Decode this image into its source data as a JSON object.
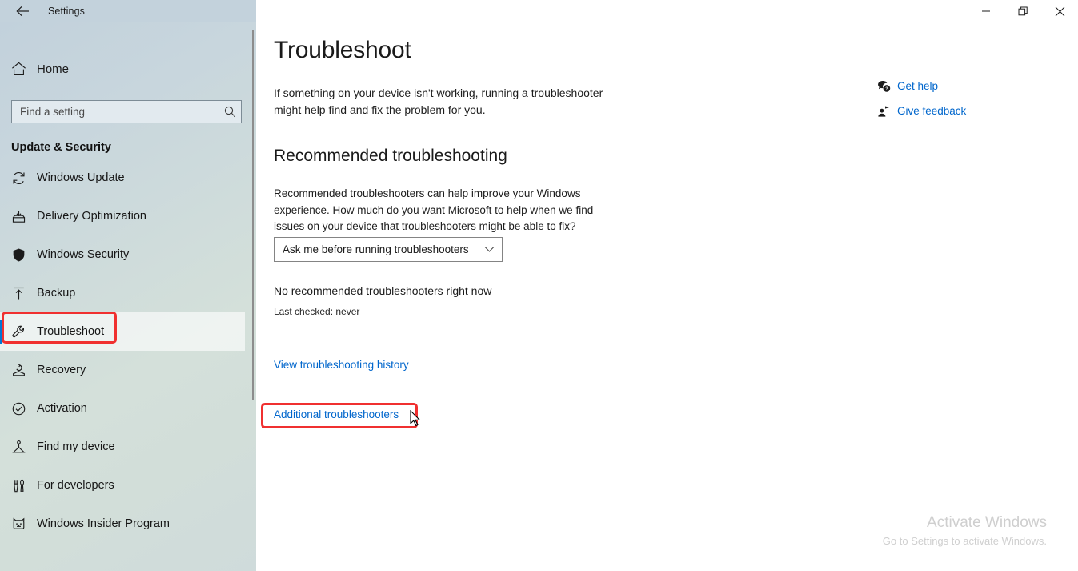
{
  "titlebar": {
    "back_icon": "back-arrow-icon",
    "title": "Settings",
    "minimize_label": "Minimize",
    "maximize_label": "Restore",
    "close_label": "Close"
  },
  "sidebar": {
    "home": {
      "label": "Home",
      "icon": "home-icon"
    },
    "search": {
      "placeholder": "Find a setting",
      "value": "",
      "icon": "search-icon"
    },
    "group_title": "Update & Security",
    "items": [
      {
        "label": "Windows Update",
        "icon": "refresh-icon",
        "selected": false
      },
      {
        "label": "Delivery Optimization",
        "icon": "delivery-icon",
        "selected": false
      },
      {
        "label": "Windows Security",
        "icon": "shield-icon",
        "selected": false
      },
      {
        "label": "Backup",
        "icon": "upload-arrow-icon",
        "selected": false
      },
      {
        "label": "Troubleshoot",
        "icon": "wrench-icon",
        "selected": true
      },
      {
        "label": "Recovery",
        "icon": "recovery-icon",
        "selected": false
      },
      {
        "label": "Activation",
        "icon": "check-circle-icon",
        "selected": false
      },
      {
        "label": "Find my device",
        "icon": "locate-device-icon",
        "selected": false
      },
      {
        "label": "For developers",
        "icon": "tools-icon",
        "selected": false
      },
      {
        "label": "Windows Insider Program",
        "icon": "insider-cat-icon",
        "selected": false
      }
    ]
  },
  "main": {
    "page_title": "Troubleshoot",
    "page_description": "If something on your device isn't working, running a troubleshooter might help find and fix the problem for you.",
    "section_title": "Recommended troubleshooting",
    "section_description": "Recommended troubleshooters can help improve your Windows experience. How much do you want Microsoft to help when we find issues on your device that troubleshooters might be able to fix?",
    "dropdown": {
      "value": "Ask me before running troubleshooters",
      "caret_icon": "chevron-down-icon",
      "options": [
        "Ask me before running troubleshooters"
      ]
    },
    "status_main": "No recommended troubleshooters right now",
    "status_sub": "Last checked: never",
    "link_history": "View troubleshooting history",
    "link_additional": "Additional troubleshooters"
  },
  "help": {
    "items": [
      {
        "label": "Get help",
        "icon": "question-bubble-icon"
      },
      {
        "label": "Give feedback",
        "icon": "feedback-person-icon"
      }
    ]
  },
  "watermark": {
    "line1": "Activate Windows",
    "line2": "Go to Settings to activate Windows."
  },
  "colors": {
    "accent": "#0078d4",
    "link": "#0066cc",
    "annotation": "#f03030",
    "sidebar_top": "#c2d1dc",
    "sidebar_bottom": "#cfdbdb",
    "watermark": "#cfcfcf"
  }
}
